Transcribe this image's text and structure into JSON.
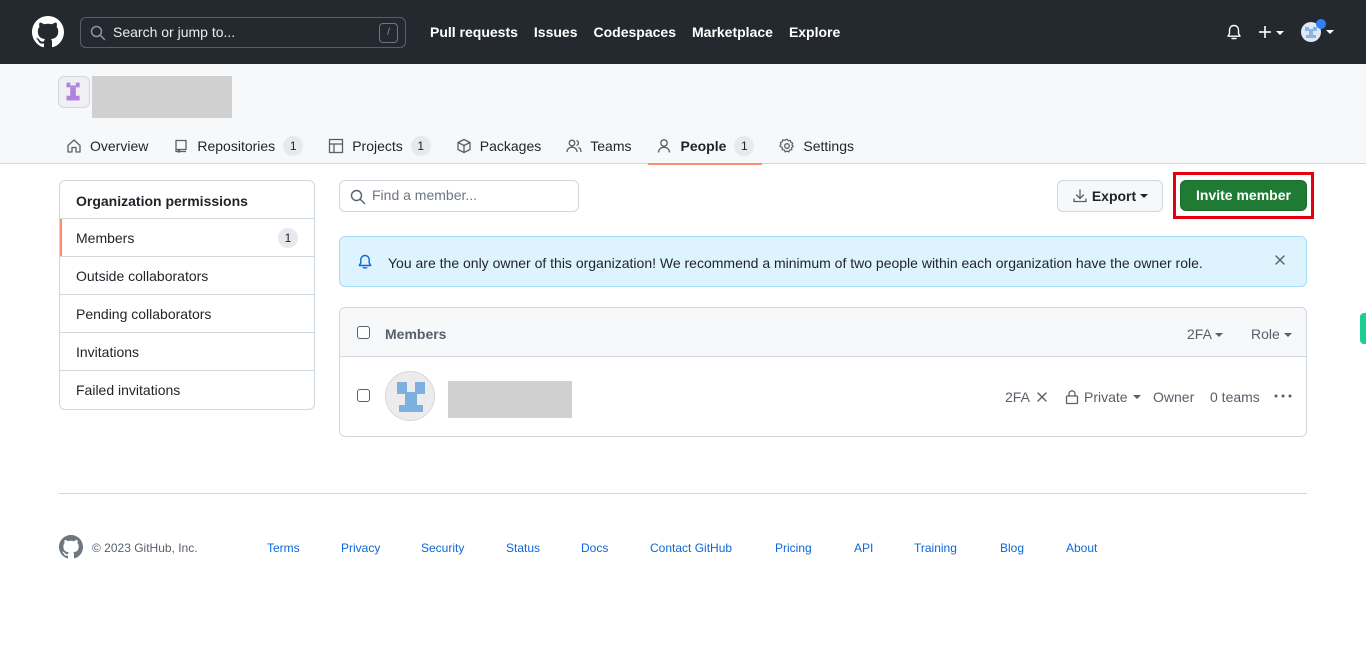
{
  "header": {
    "search_placeholder": "Search or jump to...",
    "search_shortcut": "/",
    "nav": [
      "Pull requests",
      "Issues",
      "Codespaces",
      "Marketplace",
      "Explore"
    ]
  },
  "org_tabs": [
    {
      "label": "Overview",
      "icon": "home-icon"
    },
    {
      "label": "Repositories",
      "icon": "repo-icon",
      "count": "1"
    },
    {
      "label": "Projects",
      "icon": "table-icon",
      "count": "1"
    },
    {
      "label": "Packages",
      "icon": "package-icon"
    },
    {
      "label": "Teams",
      "icon": "people-icon"
    },
    {
      "label": "People",
      "icon": "person-icon",
      "count": "1",
      "active": true
    },
    {
      "label": "Settings",
      "icon": "gear-icon"
    }
  ],
  "sidebar": {
    "heading": "Organization permissions",
    "items": [
      {
        "label": "Members",
        "count": "1",
        "active": true
      },
      {
        "label": "Outside collaborators"
      },
      {
        "label": "Pending collaborators"
      },
      {
        "label": "Invitations"
      },
      {
        "label": "Failed invitations"
      }
    ]
  },
  "toolbar": {
    "find_placeholder": "Find a member...",
    "export_label": "Export",
    "invite_label": "Invite member"
  },
  "flash": {
    "message": "You are the only owner of this organization! We recommend a minimum of two people within each organization have the owner role."
  },
  "members_table": {
    "title": "Members",
    "filter_2fa": "2FA",
    "filter_role": "Role",
    "rows": [
      {
        "twofa": "2FA",
        "visibility": "Private",
        "role": "Owner",
        "teams": "0 teams"
      }
    ]
  },
  "footer": {
    "copyright": "© 2023 GitHub, Inc.",
    "links": [
      "Terms",
      "Privacy",
      "Security",
      "Status",
      "Docs",
      "Contact GitHub",
      "Pricing",
      "API",
      "Training",
      "Blog",
      "About"
    ]
  },
  "colors": {
    "header_bg": "#24292f",
    "active_underline": "#fd8c73",
    "invite_green": "#1f7a34",
    "highlight_red": "#e3000f",
    "flash_bg": "#ddf4ff",
    "link_blue": "#0969da"
  }
}
